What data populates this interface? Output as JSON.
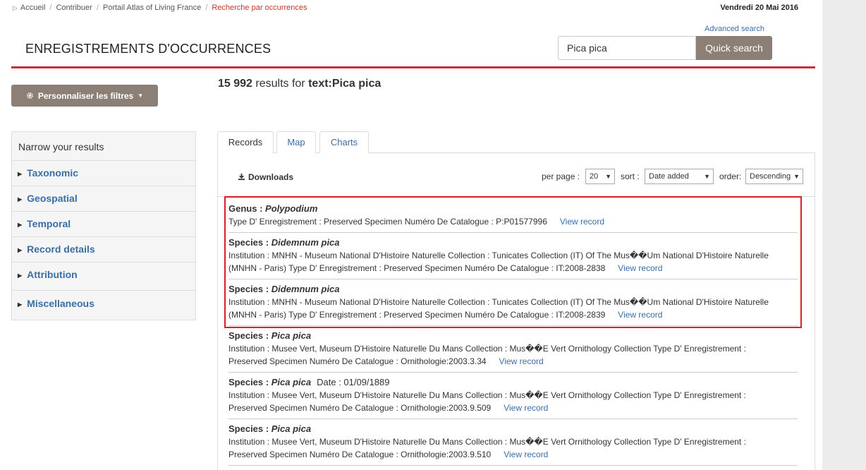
{
  "breadcrumb": {
    "items": [
      "Accueil",
      "Contribuer",
      "Portail Atlas of Living France"
    ],
    "active": "Recherche par occurrences"
  },
  "header": {
    "date": "Vendredi 20 Mai 2016",
    "advanced_search": "Advanced search",
    "title": "ENREGISTREMENTS D'OCCURRENCES",
    "search_value": "Pica pica",
    "search_button": "Quick search"
  },
  "results": {
    "count": "15 992",
    "text_prefix": "results for",
    "query": "text:Pica pica"
  },
  "filter_button": "Personnaliser les filtres",
  "facets": {
    "heading": "Narrow your results",
    "items": [
      "Taxonomic",
      "Geospatial",
      "Temporal",
      "Record details",
      "Attribution",
      "Miscellaneous"
    ]
  },
  "tabs": [
    "Records",
    "Map",
    "Charts"
  ],
  "controls": {
    "downloads": "Downloads",
    "per_page_label": "per page :",
    "per_page_value": "20",
    "sort_label": "sort :",
    "sort_value": "Date added",
    "order_label": "order:",
    "order_value": "Descending"
  },
  "records": [
    {
      "rank": "Genus :",
      "name": "Polypodium",
      "date": "",
      "lines": [
        "Type D' Enregistrement : Preserved Specimen  Numéro De Catalogue : P:P01577996"
      ],
      "view": "View record"
    },
    {
      "rank": "Species :",
      "name": "Didemnum pica",
      "date": "",
      "lines": [
        "Institution : MNHN - Museum National D'Histoire Naturelle  Collection : Tunicates Collection (IT) Of The Mus��Um National D'Histoire Naturelle",
        "(MNHN - Paris)  Type D' Enregistrement : Preserved Specimen  Numéro De Catalogue : IT:2008-2838"
      ],
      "view": "View record"
    },
    {
      "rank": "Species :",
      "name": "Didemnum pica",
      "date": "",
      "lines": [
        "Institution : MNHN - Museum National D'Histoire Naturelle  Collection : Tunicates Collection (IT) Of The Mus��Um National D'Histoire Naturelle",
        "(MNHN - Paris)  Type D' Enregistrement : Preserved Specimen  Numéro De Catalogue : IT:2008-2839"
      ],
      "view": "View record"
    },
    {
      "rank": "Species :",
      "name": "Pica pica",
      "date": "",
      "lines": [
        "Institution : Musee Vert, Museum D'Histoire Naturelle Du Mans  Collection : Mus��E Vert Ornithology Collection  Type D' Enregistrement :",
        "Preserved Specimen  Numéro De Catalogue : Ornithologie:2003.3.34"
      ],
      "view": "View record"
    },
    {
      "rank": "Species :",
      "name": "Pica pica",
      "date": "Date :  01/09/1889",
      "lines": [
        "Institution : Musee Vert, Museum D'Histoire Naturelle Du Mans  Collection : Mus��E Vert Ornithology Collection  Type D' Enregistrement :",
        "Preserved Specimen  Numéro De Catalogue : Ornithologie:2003.9.509"
      ],
      "view": "View record"
    },
    {
      "rank": "Species :",
      "name": "Pica pica",
      "date": "",
      "lines": [
        "Institution : Musee Vert, Museum D'Histoire Naturelle Du Mans  Collection : Mus��E Vert Ornithology Collection  Type D' Enregistrement :",
        "Preserved Specimen  Numéro De Catalogue : Ornithologie:2003.9.510"
      ],
      "view": "View record"
    }
  ],
  "colors": {
    "accent_red": "#c8303c",
    "button_taupe": "#8c8076",
    "link_blue": "#3a6ea5",
    "highlight_red": "#d9202a"
  },
  "icons": {
    "settings": "gear-icon",
    "download": "download-icon",
    "facet_toggle": "caret-right-icon"
  }
}
